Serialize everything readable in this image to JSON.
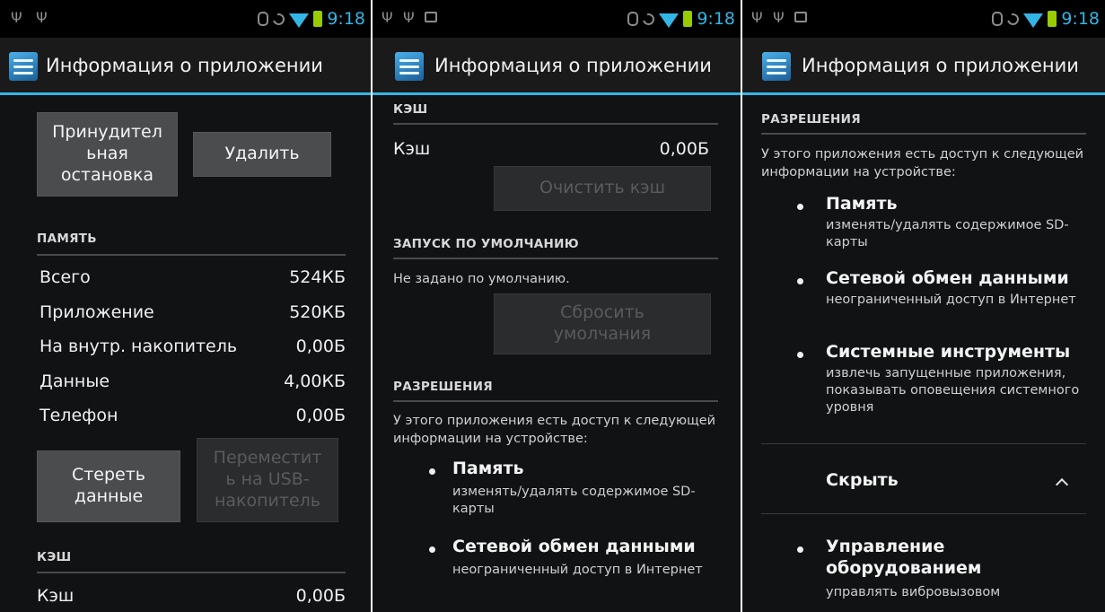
{
  "status": {
    "time": "9:18"
  },
  "title": "Информация о приложении",
  "screen1": {
    "force_stop": "Принудител ьная остановка",
    "uninstall": "Удалить",
    "memory_header": "ПАМЯТЬ",
    "rows": [
      {
        "label": "Всего",
        "value": "524КБ"
      },
      {
        "label": "Приложение",
        "value": "520КБ"
      },
      {
        "label": "На внутр. накопитель",
        "value": "0,00Б"
      },
      {
        "label": "Данные",
        "value": "4,00КБ"
      },
      {
        "label": "Телефон",
        "value": "0,00Б"
      }
    ],
    "clear_data": "Стереть данные",
    "move_usb": "Переместит ь на USB-накопитель",
    "cache_header": "КЭШ",
    "cache_label": "Кэш",
    "cache_value": "0,00Б"
  },
  "screen2": {
    "cache_header": "КЭШ",
    "cache_label": "Кэш",
    "cache_value": "0,00Б",
    "clear_cache": "Очистить кэш",
    "launch_header": "ЗАПУСК ПО УМОЛЧАНИЮ",
    "launch_text": "Не задано по умолчанию.",
    "reset_defaults": "Сбросить умолчания",
    "perm_header": "РАЗРЕШЕНИЯ",
    "perm_intro": "У этого приложения есть доступ к следующей информации на устройстве:",
    "perms": [
      {
        "title": "Память",
        "desc": "изменять/удалять содержимое SD-карты"
      },
      {
        "title": "Сетевой обмен данными",
        "desc": "неограниченный доступ в Интернет"
      }
    ]
  },
  "screen3": {
    "perm_header": "РАЗРЕШЕНИЯ",
    "perm_intro": "У этого приложения есть доступ к следующей информации на устройстве:",
    "perms": [
      {
        "title": "Память",
        "desc": "изменять/удалять содержимое SD-карты"
      },
      {
        "title": "Сетевой обмен данными",
        "desc": "неограниченный доступ в Интернет"
      },
      {
        "title": "Системные инструменты",
        "desc": "извлечь запущенные приложения, показывать оповещения системного уровня"
      }
    ],
    "hide": "Скрыть",
    "perm4_title": "Управление оборудованием",
    "perm4_desc": "управлять вибровызовом"
  }
}
